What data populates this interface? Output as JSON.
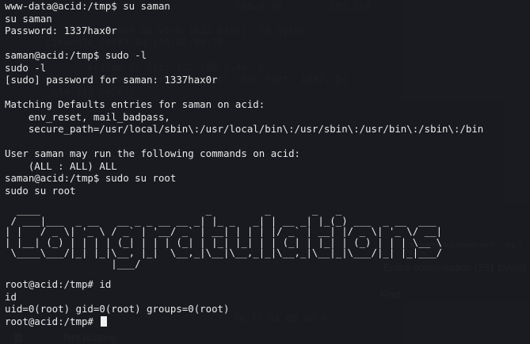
{
  "background_ghost": {
    "lines": [
      "                                       168.0.46        192.168",
      "                 bytes on wire (632 bits), 79 bytes",
      "       LiteonTe_76:f7:84 (20:68:9d:76",
      "              ersion 4, Src: 192.168.0.46, D",
      "              mission Control Protocol, Src Port: 1337, Ds",
      "        ata (10 bytes)"
    ],
    "panel_text_1": "Entire conversation (231 bytes)",
    "panel_text_2": "Find:",
    "panel_text_3": "ss.pcapng 'tcp.stream eq 0' ... ets, 7 hums",
    "hex_line": "76 f7 84 08 00 4",
    "file_label": "hint.pcapng"
  },
  "terminal": {
    "lines": [
      "www-data@acid:/tmp$ su saman",
      "su saman",
      "Password: 1337hax0r",
      "",
      "saman@acid:/tmp$ sudo -l",
      "sudo -l",
      "[sudo] password for saman: 1337hax0r",
      "",
      "Matching Defaults entries for saman on acid:",
      "    env_reset, mail_badpass,",
      "    secure_path=/usr/local/sbin\\:/usr/local/bin\\:/usr/sbin\\:/usr/bin\\:/sbin\\:/bin",
      "",
      "User saman may run the following commands on acid:",
      "    (ALL : ALL) ALL",
      "saman@acid:/tmp$ sudo su root",
      "sudo su root"
    ],
    "banner": "  ____                            _         _       _   _\n / ___|___  _ __   __ _ _ __ __ _| |_ _   _| | __ _| |_(_) ___  _ __  ___\n| |   / _ \\| '_ \\ / _` | '__/ _` | __| | | | |/ _` | __| |/ _ \\| '_ \\/ __|\n| |__| (_) | | | | (_| | | | (_| | |_| |_| | | (_| | |_| | (_) | | | \\__ \\\n \\____\\___/|_| |_|\\__, |_|  \\__,_|\\__|\\__,_|_|\\__,_|\\__|_|\\___/|_| |_|___/\n                  |___/",
    "after_lines": [
      "root@acid:/tmp# id",
      "id",
      "uid=0(root) gid=0(root) groups=0(root)"
    ],
    "prompt": "root@acid:/tmp# "
  },
  "colors": {
    "terminal_bg": "#1e1f24",
    "text": "#e9e9e9",
    "ghost_text": "#3a3c44"
  }
}
